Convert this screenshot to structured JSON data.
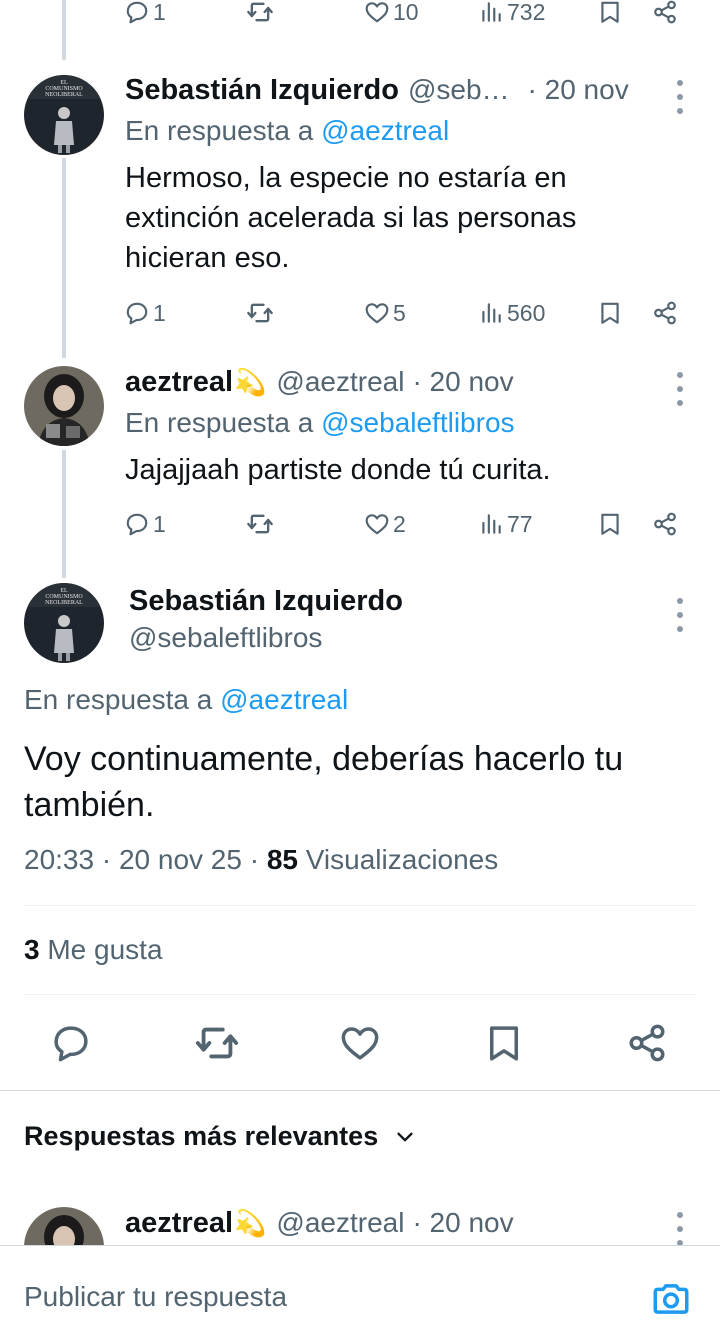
{
  "top_partial": {
    "replies": "1",
    "likes": "10",
    "views": "732"
  },
  "reply1": {
    "author_name": "Sebastián Izquierdo",
    "author_handle": "@seb…",
    "time": "· 20 nov",
    "reply_prefix": "En respuesta a",
    "reply_to": "@aeztreal",
    "text_lines": [
      "Hermoso, la especie no estaría en",
      "extinción acelerada si las personas",
      "hicieran eso."
    ],
    "replies": "1",
    "retweets": "",
    "likes": "5",
    "views": "560"
  },
  "reply2": {
    "author_name": "aeztreal",
    "author_emoji": "💫",
    "author_handle": "@aeztreal",
    "time": "· 20 nov",
    "reply_prefix": "En respuesta a",
    "reply_to": "@sebaleftlibros",
    "text": "Jajajjaah partiste donde tú curita.",
    "replies": "1",
    "retweets": "",
    "likes": "2",
    "views": "77"
  },
  "main": {
    "author_name": "Sebastián Izquierdo",
    "author_handle": "@sebaleftlibros",
    "reply_prefix": "En respuesta a",
    "reply_to": "@aeztreal",
    "text_lines": [
      "Voy continuamente, deberías hacerlo tu",
      "también."
    ],
    "time": "20:33 · 20 nov 25 ·",
    "views_count": "85",
    "views_label": "Visualizaciones",
    "likes_count": "3",
    "likes_label": "Me gusta"
  },
  "relevant": {
    "label": "Respuestas más relevantes"
  },
  "next_reply": {
    "author_name": "aeztreal",
    "author_emoji": "💫",
    "author_handle": "@aeztreal",
    "time": "· 20 nov"
  },
  "composer": {
    "placeholder": "Publicar tu respuesta"
  },
  "avatar_book": {
    "line1": "EL",
    "line2": "COMUNISMO",
    "line3": "NEOLIBERAL"
  },
  "colors": {
    "accent": "#1d9bf0",
    "muted": "#536471",
    "text": "#0f1419",
    "thread_line": "#cfd9de"
  },
  "icons": [
    "reply-icon",
    "retweet-icon",
    "like-icon",
    "views-icon",
    "bookmark-icon",
    "share-icon",
    "more-icon",
    "chevron-down-icon",
    "camera-icon"
  ]
}
